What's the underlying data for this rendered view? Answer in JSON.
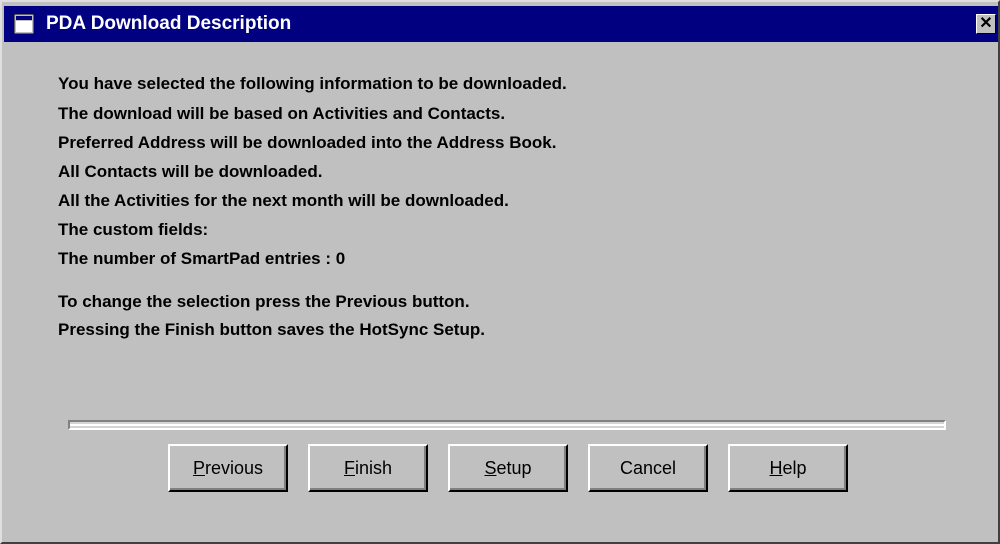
{
  "window": {
    "title": "PDA Download Description",
    "close_glyph": "✕"
  },
  "message": {
    "lines": [
      "You have selected the following information to be downloaded.",
      "The download will be based on Activities and Contacts.",
      "Preferred Address will be downloaded into the Address Book.",
      "All Contacts will be downloaded.",
      "All the Activities for the next month will be downloaded.",
      "The custom fields:",
      "The number of SmartPad entries : 0"
    ],
    "instructions": [
      "To change the selection press the Previous button.",
      "Pressing the Finish button saves the HotSync Setup."
    ]
  },
  "buttons": {
    "previous": {
      "first": "P",
      "rest": "revious"
    },
    "finish": {
      "first": "F",
      "rest": "inish"
    },
    "setup": {
      "first": "S",
      "rest": "etup"
    },
    "cancel": {
      "label": "Cancel"
    },
    "help": {
      "first": "H",
      "rest": "elp"
    }
  },
  "colors": {
    "titlebar": "#000080",
    "face": "#c0c0c0"
  }
}
